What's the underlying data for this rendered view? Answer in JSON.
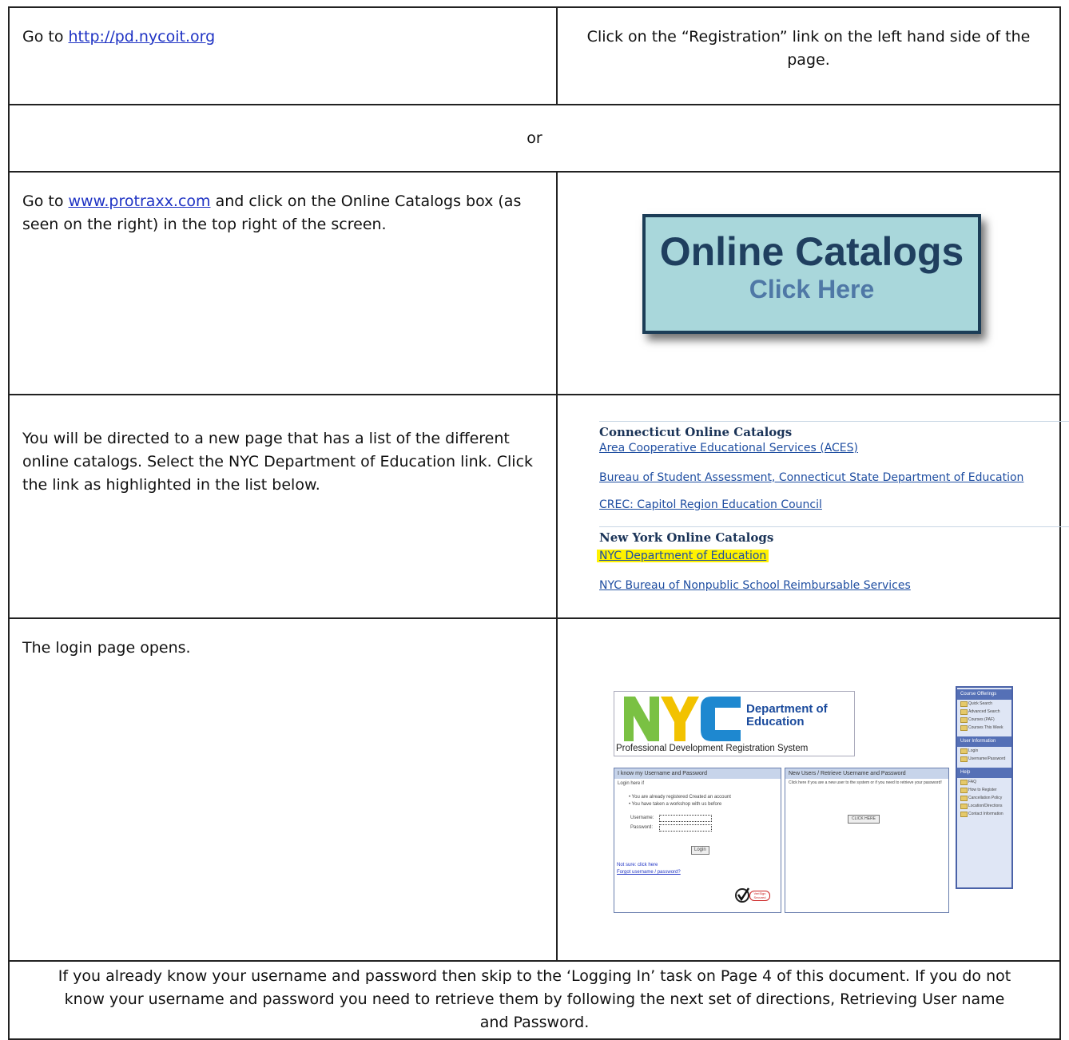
{
  "rows": {
    "r1": {
      "left_prefix": "Go to ",
      "left_link": "http://pd.nycoit.org",
      "right_text": "Click on the “Registration” link on the left hand side of the page."
    },
    "r2": {
      "text": "or"
    },
    "r3": {
      "left_prefix": "Go to ",
      "left_link": "www.protraxx.com",
      "left_suffix": " and click on the Online Catalogs box (as seen on the right) in the top right of the screen.",
      "button_title": "Online Catalogs",
      "button_subtitle": "Click Here"
    },
    "r4": {
      "left_text": "You will be directed to a new page that has a list of the different online catalogs. Select the NYC Department of Education link. Click the link as highlighted in the list below.",
      "catalog_heading_1": "Connecticut Online Catalogs",
      "catalog_items_1": [
        "Area Cooperative Educational Services (ACES)",
        "Bureau of Student Assessment, Connecticut State Department of Education",
        "CREC: Capitol Region Education Council"
      ],
      "catalog_heading_2": "New York Online Catalogs",
      "catalog_items_2": [
        "NYC Department of Education",
        "NYC Bureau of Nonpublic School Reimbursable Services"
      ]
    },
    "r5": {
      "left_text": "The login page opens.",
      "login": {
        "logo_text": "NYC",
        "dept_line1": "Department of",
        "dept_line2": "Education",
        "system_title": "Professional Development Registration System",
        "box1_header": "I know my Username and Password",
        "box1_sub": "Login here if",
        "box1_bullets": [
          "You are already registered Created an account",
          "You have taken a workshop with us before"
        ],
        "username_label": "Username:",
        "password_label": "Password:",
        "login_button": "Login",
        "not_sure": "Not sure: click here",
        "forgot_link": "Forgot username / password?",
        "verisign": "VeriSign Secured",
        "box2_header": "New Users / Retrieve Username and Password",
        "box2_sub": "Click here if you are a new user to the system or if you need to retrieve your password!",
        "click_here": "CLICK HERE",
        "side_sections": [
          {
            "title": "Course Offerings",
            "items": [
              "Quick Search",
              "Advanced Search",
              "Courses (PAF)",
              "Courses This Week"
            ]
          },
          {
            "title": "User Information",
            "items": [
              "Login",
              "Username/Password"
            ]
          },
          {
            "title": "Help",
            "items": [
              "FAQ",
              "How to Register",
              "Cancellation Policy",
              "Location/Directions",
              "Contact Information"
            ]
          }
        ]
      }
    },
    "r6": {
      "text": "If you already know your username and password then skip to the ‘Logging In’ task on Page 4 of this document. If you do not know your username and password you need to retrieve them by following the next set of directions, Retrieving User name and Password."
    }
  },
  "colors": {
    "link": "#1f33c4",
    "highlight": "#fff200",
    "button_bg": "#a9d7db"
  }
}
